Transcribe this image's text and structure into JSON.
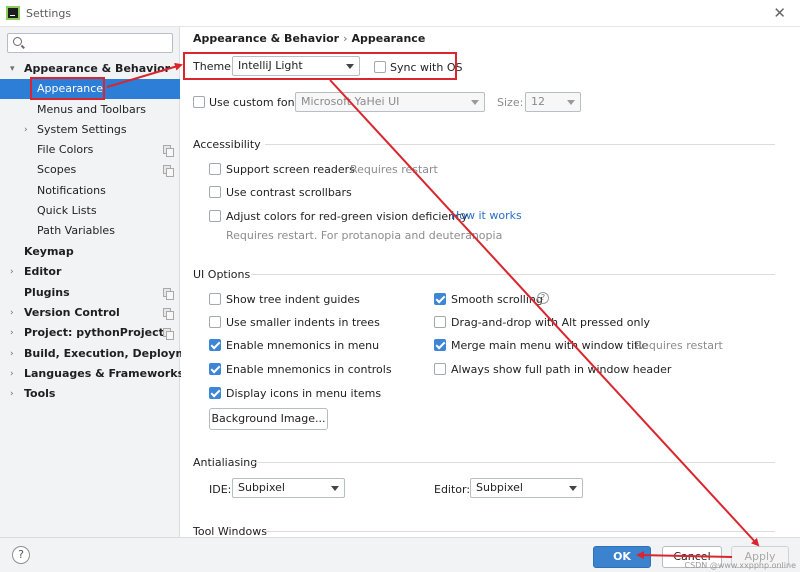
{
  "window": {
    "title": "Settings",
    "close_symbol": "✕"
  },
  "sidebar": {
    "search_placeholder": "",
    "items": [
      {
        "label": "Appearance & Behavior",
        "bold": true,
        "arrow": "▾"
      },
      {
        "label": "Appearance",
        "selected": true
      },
      {
        "label": "Menus and Toolbars"
      },
      {
        "label": "System Settings",
        "arrow": "›"
      },
      {
        "label": "File Colors"
      },
      {
        "label": "Scopes"
      },
      {
        "label": "Notifications"
      },
      {
        "label": "Quick Lists"
      },
      {
        "label": "Path Variables"
      },
      {
        "label": "Keymap",
        "bold": true
      },
      {
        "label": "Editor",
        "bold": true,
        "arrow": "›"
      },
      {
        "label": "Plugins",
        "bold": true
      },
      {
        "label": "Version Control",
        "bold": true,
        "arrow": "›"
      },
      {
        "label": "Project: pythonProject",
        "bold": true,
        "arrow": "›"
      },
      {
        "label": "Build, Execution, Deployment",
        "bold": true,
        "arrow": "›"
      },
      {
        "label": "Languages & Frameworks",
        "bold": true,
        "arrow": "›"
      },
      {
        "label": "Tools",
        "bold": true,
        "arrow": "›"
      }
    ]
  },
  "breadcrumb": {
    "parent": "Appearance & Behavior",
    "separator": "›",
    "current": "Appearance"
  },
  "theme": {
    "label": "Theme:",
    "value": "IntelliJ Light",
    "sync_label": "Sync with OS",
    "sync_checked": false
  },
  "font": {
    "custom_label": "Use custom font:",
    "custom_checked": false,
    "family": "Microsoft YaHei UI",
    "size_label": "Size:",
    "size": "12"
  },
  "accessibility": {
    "title": "Accessibility",
    "screen_readers": {
      "label": "Support screen readers",
      "hint": "Requires restart",
      "checked": false
    },
    "contrast_scrollbars": {
      "label": "Use contrast scrollbars",
      "checked": false
    },
    "color_deficiency": {
      "label": "Adjust colors for red-green vision deficiency",
      "link": "How it works",
      "note": "Requires restart. For protanopia and deuteranopia",
      "checked": false
    }
  },
  "ui_options": {
    "title": "UI Options",
    "tree_indent": {
      "label": "Show tree indent guides",
      "checked": false
    },
    "smaller_indents": {
      "label": "Use smaller indents in trees",
      "checked": false
    },
    "mnemonics_menu": {
      "label": "Enable mnemonics in menu",
      "checked": true
    },
    "mnemonics_controls": {
      "label": "Enable mnemonics in controls",
      "checked": true
    },
    "icons_menu": {
      "label": "Display icons in menu items",
      "checked": true
    },
    "smooth_scrolling": {
      "label": "Smooth scrolling",
      "checked": true,
      "help": "?"
    },
    "drag_drop_alt": {
      "label": "Drag-and-drop with Alt pressed only",
      "checked": false
    },
    "merge_menu": {
      "label": "Merge main menu with window title",
      "hint": "Requires restart",
      "checked": true
    },
    "full_path": {
      "label": "Always show full path in window header",
      "checked": false
    },
    "background_image_button": "Background Image..."
  },
  "antialiasing": {
    "title": "Antialiasing",
    "ide_label": "IDE:",
    "ide_value": "Subpixel",
    "editor_label": "Editor:",
    "editor_value": "Subpixel"
  },
  "tool_windows": {
    "title": "Tool Windows"
  },
  "footer": {
    "help": "?",
    "ok": "OK",
    "cancel": "Cancel",
    "apply": "Apply",
    "watermark": "CSDN @www.xxpphp.online"
  },
  "colors": {
    "accent": "#2d7ed6",
    "annotation": "#d9262e"
  }
}
